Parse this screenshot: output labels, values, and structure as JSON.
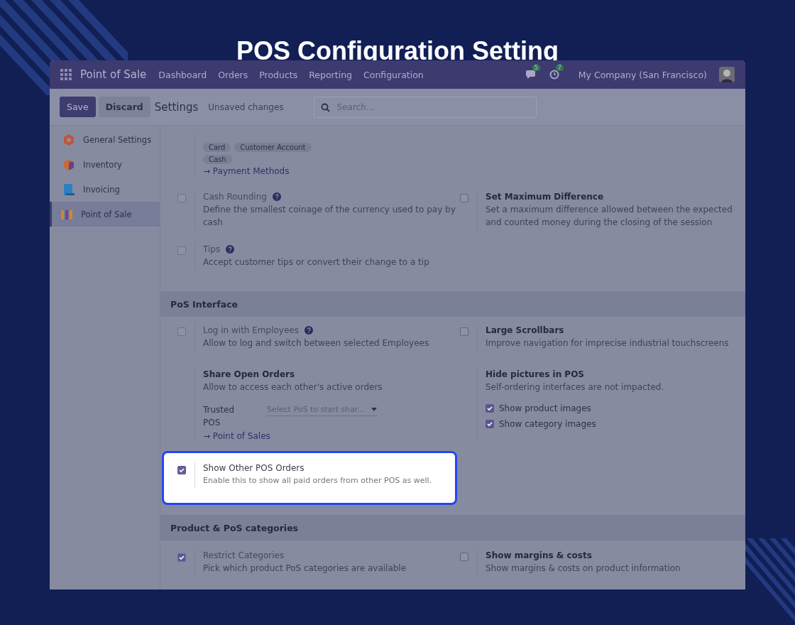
{
  "page_title": "POS Configuration Setting",
  "navbar": {
    "app_name": "Point of Sale",
    "menu": [
      "Dashboard",
      "Orders",
      "Products",
      "Reporting",
      "Configuration"
    ],
    "messages_count": "5",
    "activities_count": "7",
    "company": "My Company (San Francisco)"
  },
  "control_bar": {
    "save": "Save",
    "discard": "Discard",
    "breadcrumb": "Settings",
    "status": "Unsaved changes",
    "search": {
      "placeholder": "Search..."
    }
  },
  "sidebar": {
    "items": [
      {
        "label": "General Settings",
        "selected": false,
        "kind": "general"
      },
      {
        "label": "Inventory",
        "selected": false,
        "kind": "inventory"
      },
      {
        "label": "Invoicing",
        "selected": false,
        "kind": "invoicing"
      },
      {
        "label": "Point of Sale",
        "selected": true,
        "kind": "pos"
      }
    ]
  },
  "sections": [
    {
      "rows": [
        [
          {
            "kind": "tags",
            "tags": [
              "Card",
              "Customer Account",
              "Cash"
            ],
            "link": "→ Payment Methods"
          }
        ],
        [
          {
            "kind": "checkbox",
            "title": "Cash Rounding",
            "help": true,
            "disabled": true,
            "checked": false,
            "description": "Define the smallest coinage of the currency used to pay by cash"
          },
          {
            "kind": "checkbox",
            "title": "Set Maximum Difference",
            "disabled": false,
            "checked": false,
            "description": "Set a maximum difference allowed between the expected and counted money during the closing of the session"
          }
        ],
        [
          {
            "kind": "checkbox",
            "title": "Tips",
            "help": true,
            "disabled": true,
            "checked": false,
            "description": "Accept customer tips or convert their change to a tip"
          }
        ]
      ]
    },
    {
      "title": "PoS Interface",
      "rows": [
        [
          {
            "kind": "checkbox",
            "title": "Log in with Employees",
            "help": true,
            "disabled": true,
            "checked": false,
            "description": "Allow to log and switch between selected Employees"
          },
          {
            "kind": "checkbox",
            "title": "Large Scrollbars",
            "disabled": false,
            "checked": false,
            "description": "Improve navigation for imprecise industrial touchscreens"
          }
        ],
        [
          {
            "kind": "select",
            "title": "Share Open Orders",
            "description": "Allow to access each other's active orders",
            "field_label": "Trusted POS",
            "placeholder": "Select PoS to start shar...",
            "link": "→ Point of Sales"
          },
          {
            "kind": "options",
            "title": "Hide pictures in POS",
            "description": "Self-ordering interfaces are not impacted.",
            "options": [
              {
                "label": "Show product images",
                "checked": true
              },
              {
                "label": "Show category images",
                "checked": true
              }
            ]
          }
        ],
        [
          {
            "kind": "checkbox",
            "title": "Show Other POS Orders",
            "disabled": false,
            "checked": true,
            "highlighted": true,
            "description": "Enable this to show all paid orders from other POS as well."
          }
        ]
      ]
    },
    {
      "title": "Product & PoS categories",
      "rows": [
        [
          {
            "kind": "checkbox",
            "title": "Restrict Categories",
            "disabled": true,
            "checked": true,
            "description": "Pick which product PoS categories are available"
          },
          {
            "kind": "checkbox",
            "title": "Show margins & costs",
            "disabled": false,
            "checked": false,
            "description": "Show margins & costs on product information"
          }
        ]
      ]
    }
  ]
}
